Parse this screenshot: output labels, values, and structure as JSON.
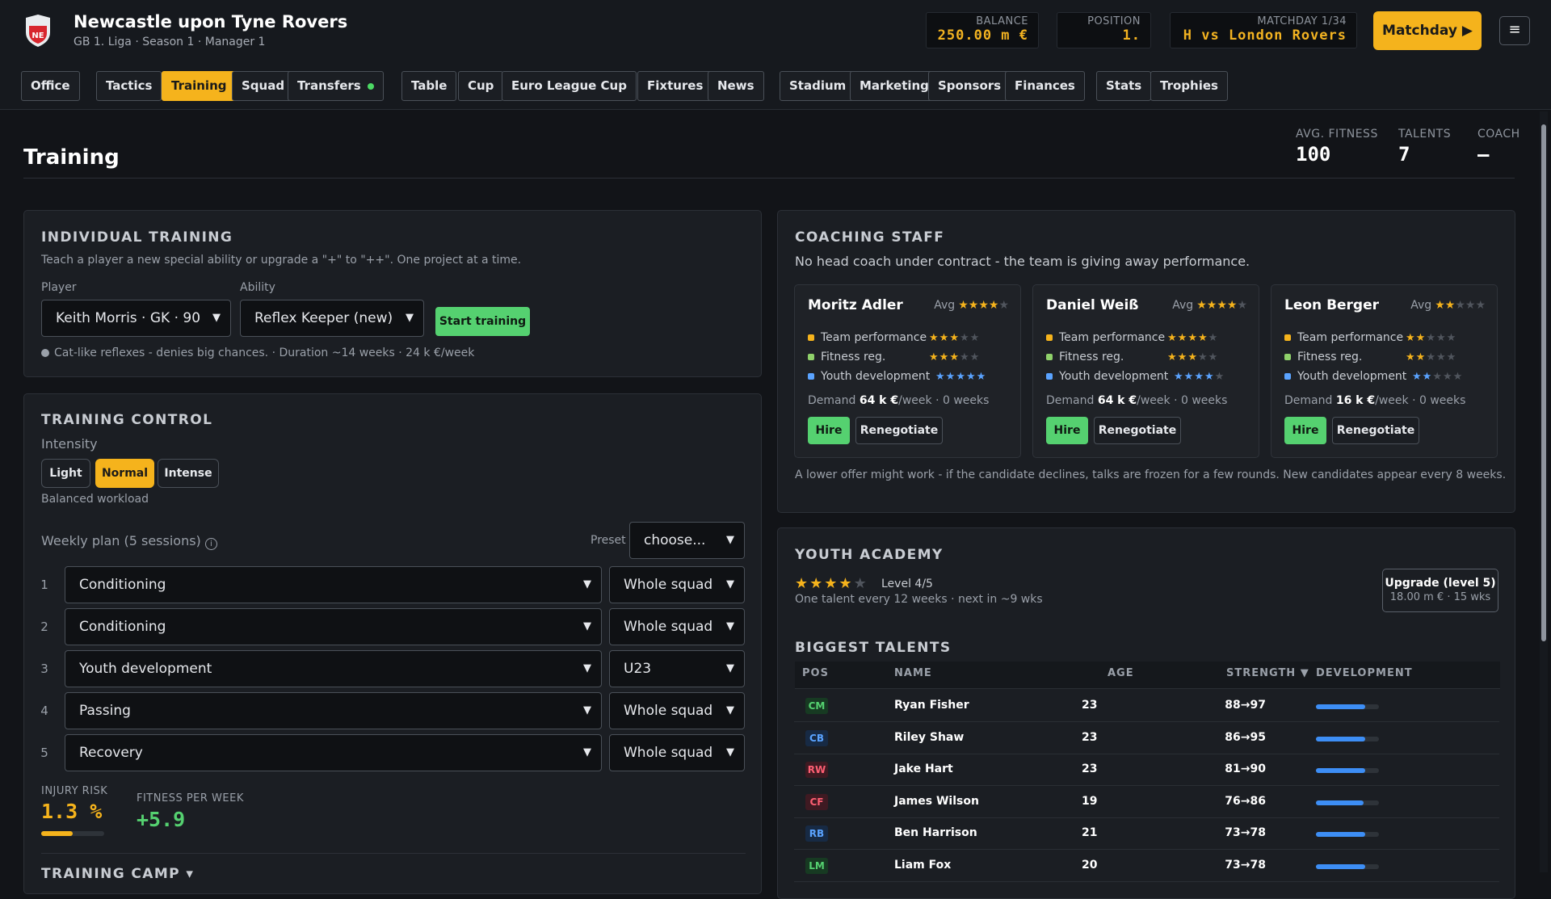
{
  "header": {
    "crest_text": "NE",
    "club_name": "Newcastle upon Tyne Rovers",
    "club_sub": "GB 1. Liga · Season 1 · Manager 1",
    "balance_label": "BALANCE",
    "balance_value": "250.00 m €",
    "position_label": "POSITION",
    "position_value": "1.",
    "matchday_label": "MATCHDAY 1/34",
    "matchday_value": "H vs London Rovers",
    "matchday_button": "Matchday ▶",
    "menu_icon": "≡"
  },
  "nav": {
    "tabs": [
      "Office",
      "Tactics",
      "Training",
      "Squad",
      "Transfers",
      "Table",
      "Cup",
      "Euro League Cup",
      "Fixtures",
      "News",
      "Stadium",
      "Marketing",
      "Sponsors",
      "Finances",
      "Stats",
      "Trophies"
    ],
    "active": "Training"
  },
  "page": {
    "title": "Training",
    "stats": [
      {
        "label": "AVG. FITNESS",
        "value": "100"
      },
      {
        "label": "TALENTS",
        "value": "7"
      },
      {
        "label": "COACH",
        "value": "–"
      }
    ]
  },
  "individual_training": {
    "title": "INDIVIDUAL TRAINING",
    "desc": "Teach a player a new special ability or upgrade a \"+\" to \"++\". One project at a time.",
    "player_label": "Player",
    "player_value": "Keith Morris · GK · 90",
    "ability_label": "Ability",
    "ability_value": "Reflex Keeper (new)",
    "start_button": "Start training",
    "note": "Cat-like reflexes - denies big chances. · Duration ~14 weeks · 24 k €/week"
  },
  "training_control": {
    "title": "TRAINING CONTROL",
    "intensity_label": "Intensity",
    "intensity_options": [
      "Light",
      "Normal",
      "Intense"
    ],
    "intensity_selected": "Normal",
    "intensity_note": "Balanced workload",
    "plan_label": "Weekly plan (5 sessions)",
    "preset_label": "Preset",
    "preset_value": "choose...",
    "sessions": [
      {
        "num": "1",
        "type": "Conditioning",
        "group": "Whole squad"
      },
      {
        "num": "2",
        "type": "Conditioning",
        "group": "Whole squad"
      },
      {
        "num": "3",
        "type": "Youth development",
        "group": "U23"
      },
      {
        "num": "4",
        "type": "Passing",
        "group": "Whole squad"
      },
      {
        "num": "5",
        "type": "Recovery",
        "group": "Whole squad"
      }
    ],
    "injury_label": "INJURY RISK",
    "injury_value": "1.3 %",
    "injury_bar_fraction": 0.5,
    "fitness_label": "FITNESS PER WEEK",
    "fitness_value": "+5.9",
    "next_section": "TRAINING CAMP ▾"
  },
  "coaching_staff": {
    "title": "COACHING STAFF",
    "note": "No head coach under contract - the team is giving away performance.",
    "avg_label": "Avg",
    "attr_labels": [
      "Team performance",
      "Fitness reg.",
      "Youth development"
    ],
    "attr_colors": [
      "#f5b31c",
      "#8fd16a",
      "#5aa3ff"
    ],
    "demand_label": "Demand",
    "hire_label": "Hire",
    "renegotiate_label": "Renegotiate",
    "coaches": [
      {
        "name": "Moritz Adler",
        "avg": 4,
        "attrs": [
          3,
          3,
          5
        ],
        "demand": "64 k €",
        "demand_rest": "/week · 0 weeks"
      },
      {
        "name": "Daniel Weiß",
        "avg": 4,
        "attrs": [
          4,
          3,
          4
        ],
        "demand": "64 k €",
        "demand_rest": "/week · 0 weeks"
      },
      {
        "name": "Leon Berger",
        "avg": 2,
        "attrs": [
          2,
          2,
          2
        ],
        "demand": "16 k €",
        "demand_rest": "/week · 0 weeks"
      }
    ],
    "footnote": "A lower offer might work - if the candidate declines, talks are frozen for a few rounds. New candidates appear every 8 weeks."
  },
  "youth_academy": {
    "title": "YOUTH ACADEMY",
    "level_stars": 4,
    "level_text": "Level 4/5",
    "rate_text": "One talent every 12 weeks · next in ~9 wks",
    "upgrade_title": "Upgrade (level 5)",
    "upgrade_sub": "18.00 m € · 15 wks",
    "talents_title": "BIGGEST TALENTS",
    "columns": [
      "POS",
      "NAME",
      "AGE",
      "STRENGTH ▼",
      "DEVELOPMENT"
    ],
    "talents": [
      {
        "pos": "CM",
        "name": "Ryan Fisher",
        "age": "23",
        "strength": "88→97",
        "dev": 0.78
      },
      {
        "pos": "CB",
        "name": "Riley Shaw",
        "age": "23",
        "strength": "86→95",
        "dev": 0.78
      },
      {
        "pos": "RW",
        "name": "Jake Hart",
        "age": "23",
        "strength": "81→90",
        "dev": 0.78
      },
      {
        "pos": "CF",
        "name": "James Wilson",
        "age": "19",
        "strength": "76→86",
        "dev": 0.75
      },
      {
        "pos": "RB",
        "name": "Ben Harrison",
        "age": "21",
        "strength": "73→78",
        "dev": 0.78
      },
      {
        "pos": "LM",
        "name": "Liam Fox",
        "age": "20",
        "strength": "73→78",
        "dev": 0.78
      }
    ],
    "pos_colors": {
      "CM": [
        "#173a22",
        "#55d170"
      ],
      "CB": [
        "#172a44",
        "#5aa3ff"
      ],
      "RW": [
        "#3f1a22",
        "#ff5f73"
      ],
      "CF": [
        "#3f1a22",
        "#ff5f73"
      ],
      "RB": [
        "#172a44",
        "#5aa3ff"
      ],
      "LM": [
        "#173a22",
        "#55d170"
      ]
    }
  }
}
